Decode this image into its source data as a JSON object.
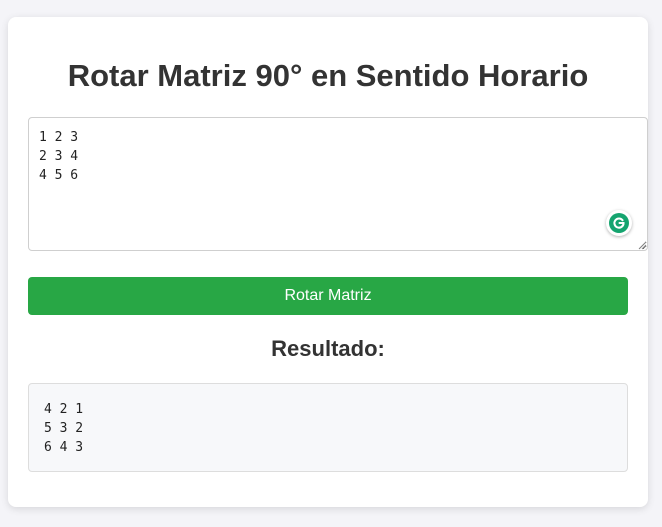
{
  "page": {
    "title": "Rotar Matriz 90° en Sentido Horario"
  },
  "input": {
    "value": "1 2 3\n2 3 4\n4 5 6"
  },
  "button": {
    "label": "Rotar Matriz"
  },
  "result": {
    "heading": "Resultado:",
    "output": "4 2 1\n5 3 2\n6 4 3"
  },
  "colors": {
    "button_bg": "#28a745",
    "grammarly": "#15a46f",
    "heading_text": "#333333"
  },
  "icons": {
    "grammarly": "grammarly-icon",
    "resize": "resize-grip-icon"
  }
}
